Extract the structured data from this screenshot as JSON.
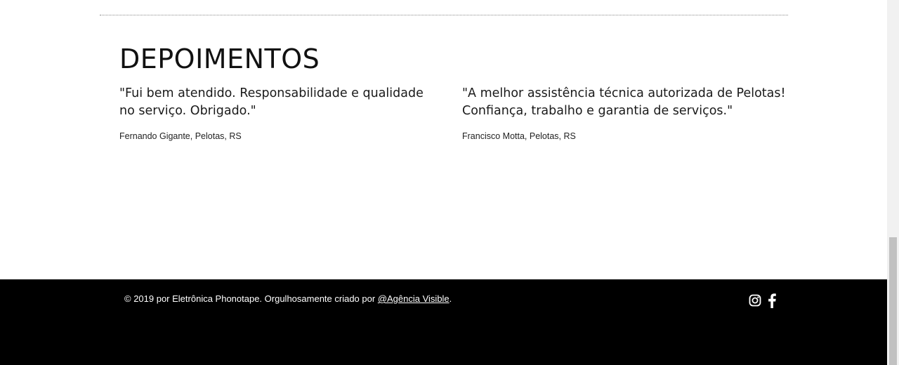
{
  "testimonials_section": {
    "heading": "DEPOIMENTOS",
    "items": [
      {
        "quote": "\"Fui bem atendido. Responsabilidade e qualidade no serviço. Obrigado.\"",
        "author": "Fernando Gigante, Pelotas, RS"
      },
      {
        "quote": "\"A melhor assistência técnica autorizada de Pelotas! Confiança, trabalho e garantia de serviços.\"",
        "author": "Francisco Motta, Pelotas, RS"
      }
    ]
  },
  "footer": {
    "copyright_prefix": "© 2019 por Eletrônica Phonotape. Orgulhosamente criado por ",
    "agency_link": "@Agência Visible",
    "copyright_suffix": ".",
    "social_icons": [
      "instagram-icon",
      "facebook-icon"
    ]
  },
  "colors": {
    "background": "#ffffff",
    "footer_background": "#000000",
    "footer_text": "#ffffff",
    "body_text": "#1a1a1a"
  }
}
